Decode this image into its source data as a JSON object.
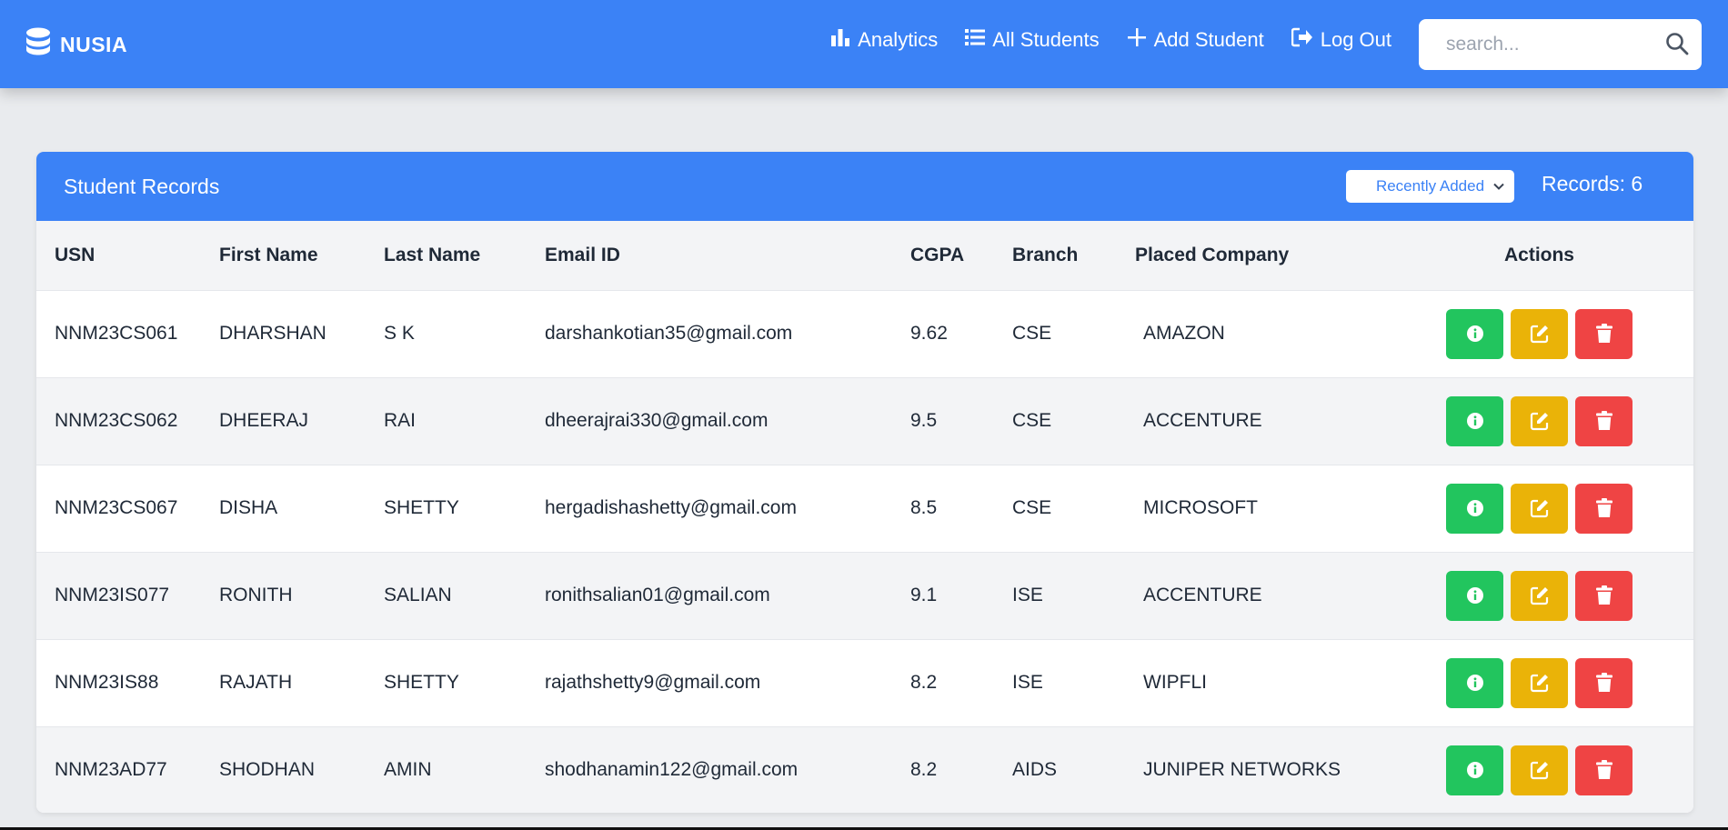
{
  "navbar": {
    "brand": "NUSIA",
    "brand_icon": "database-icon",
    "links": [
      {
        "label": "Analytics",
        "icon": "chart-bar-icon"
      },
      {
        "label": "All Students",
        "icon": "list-icon"
      },
      {
        "label": "Add Student",
        "icon": "plus-icon"
      },
      {
        "label": "Log Out",
        "icon": "logout-icon"
      }
    ],
    "search_placeholder": "search..."
  },
  "records": {
    "title": "Student Records",
    "sort_selected": "Recently Added",
    "count_label": "Records: 6"
  },
  "table": {
    "headers": [
      "USN",
      "First Name",
      "Last Name",
      "Email ID",
      "CGPA",
      "Branch",
      "Placed Company",
      "Actions"
    ],
    "rows": [
      [
        "NNM23CS061",
        "DHARSHAN",
        "S K",
        "darshankotian35@gmail.com",
        "9.62",
        "CSE",
        "AMAZON"
      ],
      [
        "NNM23CS062",
        "DHEERAJ",
        "RAI",
        "dheerajrai330@gmail.com",
        "9.5",
        "CSE",
        "ACCENTURE"
      ],
      [
        "NNM23CS067",
        "DISHA",
        "SHETTY",
        "hergadishashetty@gmail.com",
        "8.5",
        "CSE",
        "MICROSOFT"
      ],
      [
        "NNM23IS077",
        "RONITH",
        "SALIAN",
        "ronithsalian01@gmail.com",
        "9.1",
        "ISE",
        "ACCENTURE"
      ],
      [
        "NNM23IS88",
        "RAJATH",
        "SHETTY",
        "rajathshetty9@gmail.com",
        "8.2",
        "ISE",
        "WIPFLI"
      ],
      [
        "NNM23AD77",
        "SHODHAN",
        "AMIN",
        "shodhanamin122@gmail.com",
        "8.2",
        "AIDS",
        "JUNIPER NETWORKS"
      ]
    ]
  },
  "colors": {
    "primary": "#3b82f6",
    "info": "#22c55e",
    "edit": "#eab308",
    "delete": "#ef4444"
  }
}
